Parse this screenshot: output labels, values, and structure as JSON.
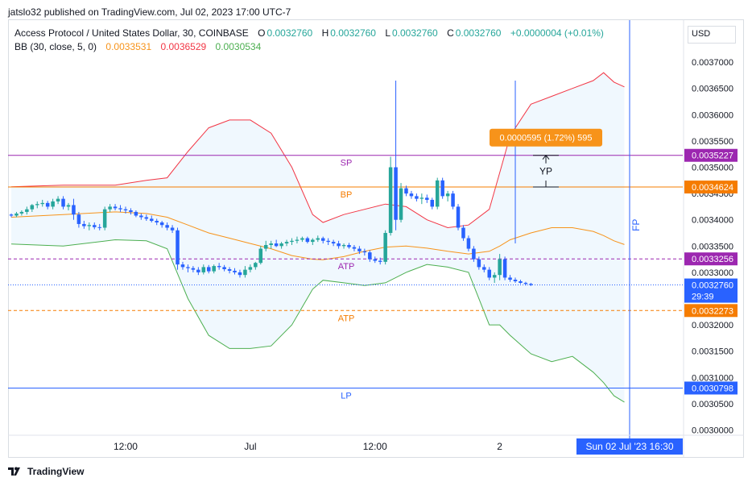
{
  "header": {
    "publisher_note": "jatslo32 published on TradingView.com, Jul 02, 2023 17:00 UTC-7"
  },
  "legend": {
    "symbol": "Access Protocol / United States Dollar, 30, COINBASE",
    "o_label": "O",
    "o_value": "0.0032760",
    "h_label": "H",
    "h_value": "0.0032760",
    "l_label": "L",
    "l_value": "0.0032760",
    "c_label": "C",
    "c_value": "0.0032760",
    "change": "+0.0000004 (+0.01%)",
    "bb_label": "BB (30, close, 5, 0)",
    "bb_basis": "0.0033531",
    "bb_upper": "0.0036529",
    "bb_lower": "0.0030534"
  },
  "currency": "USD",
  "footer": {
    "brand": "TradingView"
  },
  "colors": {
    "up": "#26a69a",
    "down": "#2962ff",
    "upper": "#f23645",
    "basis": "#f7931a",
    "lower": "#4caf50",
    "fill": "#e3f2fd",
    "sp": "#9c27b0",
    "bp": "#f57c00",
    "lp": "#2962ff",
    "atp_top": "#9c27b0",
    "atp_bottom": "#f57c00",
    "last": "#2962ff",
    "fp": "#2962ff"
  },
  "chart_data": {
    "type": "candlestick",
    "ylim": [
      0.00299,
      0.00378
    ],
    "y_ticks": [
      "0.0030000",
      "0.0030500",
      "0.0031000",
      "0.0031500",
      "0.0032000",
      "0.0032500",
      "0.0033000",
      "0.0033500",
      "0.0034000",
      "0.0034500",
      "0.0035000",
      "0.0035500",
      "0.0036000",
      "0.0036500",
      "0.0037000"
    ],
    "x_ticks": [
      {
        "index": 22,
        "label": "12:00"
      },
      {
        "index": 46,
        "label": "Jul"
      },
      {
        "index": 70,
        "label": "12:00"
      },
      {
        "index": 94,
        "label": "2"
      }
    ],
    "candles": [
      [
        0.00341,
        0.003412,
        0.003405,
        0.003408
      ],
      [
        0.003408,
        0.003415,
        0.003405,
        0.003412
      ],
      [
        0.003412,
        0.003418,
        0.003408,
        0.003415
      ],
      [
        0.003415,
        0.003425,
        0.00341,
        0.00342
      ],
      [
        0.00342,
        0.00343,
        0.003415,
        0.003428
      ],
      [
        0.003428,
        0.003435,
        0.003422,
        0.00343
      ],
      [
        0.00343,
        0.003438,
        0.003425,
        0.003432
      ],
      [
        0.003432,
        0.003436,
        0.00342,
        0.003425
      ],
      [
        0.003425,
        0.00344,
        0.00342,
        0.003435
      ],
      [
        0.003435,
        0.003445,
        0.00343,
        0.00344
      ],
      [
        0.00344,
        0.003445,
        0.00342,
        0.003425
      ],
      [
        0.003425,
        0.003432,
        0.003418,
        0.003428
      ],
      [
        0.003428,
        0.00344,
        0.0034,
        0.00341
      ],
      [
        0.00341,
        0.003415,
        0.003385,
        0.003392
      ],
      [
        0.003392,
        0.003398,
        0.003383,
        0.003388
      ],
      [
        0.003388,
        0.003395,
        0.00338,
        0.00339
      ],
      [
        0.00339,
        0.003395,
        0.003382,
        0.003386
      ],
      [
        0.003386,
        0.003392,
        0.00338,
        0.003385
      ],
      [
        0.003385,
        0.003425,
        0.00338,
        0.00342
      ],
      [
        0.00342,
        0.00343,
        0.003415,
        0.003425
      ],
      [
        0.003425,
        0.00343,
        0.003418,
        0.003422
      ],
      [
        0.003422,
        0.003428,
        0.003415,
        0.00342
      ],
      [
        0.00342,
        0.003425,
        0.003412,
        0.003418
      ],
      [
        0.003418,
        0.003422,
        0.00341,
        0.003415
      ],
      [
        0.003415,
        0.003418,
        0.003405,
        0.003408
      ],
      [
        0.003408,
        0.003412,
        0.0034,
        0.003405
      ],
      [
        0.003405,
        0.00341,
        0.003398,
        0.003402
      ],
      [
        0.003402,
        0.003408,
        0.003395,
        0.003398
      ],
      [
        0.003398,
        0.003402,
        0.00339,
        0.003395
      ],
      [
        0.003395,
        0.003398,
        0.003385,
        0.00339
      ],
      [
        0.00339,
        0.003395,
        0.00338,
        0.003385
      ],
      [
        0.003385,
        0.00339,
        0.003375,
        0.00338
      ],
      [
        0.00338,
        0.003385,
        0.003305,
        0.003315
      ],
      [
        0.003315,
        0.00332,
        0.003305,
        0.00331
      ],
      [
        0.00331,
        0.003315,
        0.0033,
        0.003308
      ],
      [
        0.003308,
        0.003312,
        0.0033,
        0.003305
      ],
      [
        0.003305,
        0.00331,
        0.003295,
        0.0033
      ],
      [
        0.0033,
        0.003315,
        0.003296,
        0.00331
      ],
      [
        0.00331,
        0.003314,
        0.003298,
        0.003302
      ],
      [
        0.003302,
        0.003315,
        0.003298,
        0.003312
      ],
      [
        0.003312,
        0.003318,
        0.003305,
        0.00331
      ],
      [
        0.00331,
        0.003314,
        0.003302,
        0.003306
      ],
      [
        0.003306,
        0.00331,
        0.003298,
        0.003303
      ],
      [
        0.003303,
        0.003308,
        0.003296,
        0.0033
      ],
      [
        0.0033,
        0.003305,
        0.00329,
        0.003295
      ],
      [
        0.003295,
        0.003312,
        0.00329,
        0.003305
      ],
      [
        0.003305,
        0.003315,
        0.0033,
        0.00331
      ],
      [
        0.00331,
        0.00332,
        0.003305,
        0.003318
      ],
      [
        0.003318,
        0.00335,
        0.003315,
        0.003345
      ],
      [
        0.003345,
        0.00336,
        0.00334,
        0.003352
      ],
      [
        0.003352,
        0.00336,
        0.003345,
        0.003355
      ],
      [
        0.003355,
        0.003362,
        0.003348,
        0.00335
      ],
      [
        0.00335,
        0.003358,
        0.003345,
        0.003355
      ],
      [
        0.003355,
        0.003362,
        0.00335,
        0.003358
      ],
      [
        0.003358,
        0.003365,
        0.003352,
        0.00336
      ],
      [
        0.00336,
        0.003368,
        0.003355,
        0.003362
      ],
      [
        0.003362,
        0.003368,
        0.003358,
        0.003365
      ],
      [
        0.003365,
        0.003368,
        0.003355,
        0.003358
      ],
      [
        0.003358,
        0.003365,
        0.003352,
        0.003362
      ],
      [
        0.003362,
        0.00337,
        0.003358,
        0.003365
      ],
      [
        0.003365,
        0.003368,
        0.003355,
        0.00336
      ],
      [
        0.00336,
        0.003365,
        0.003352,
        0.003358
      ],
      [
        0.003358,
        0.003362,
        0.00335,
        0.003355
      ],
      [
        0.003355,
        0.00336,
        0.003345,
        0.00335
      ],
      [
        0.00335,
        0.003355,
        0.003345,
        0.003352
      ],
      [
        0.003352,
        0.003356,
        0.003345,
        0.003348
      ],
      [
        0.003348,
        0.003352,
        0.00334,
        0.003345
      ],
      [
        0.003345,
        0.00335,
        0.003335,
        0.00334
      ],
      [
        0.00334,
        0.003345,
        0.003332,
        0.003338
      ],
      [
        0.003338,
        0.003342,
        0.00332,
        0.003325
      ],
      [
        0.003325,
        0.00333,
        0.003318,
        0.003322
      ],
      [
        0.003322,
        0.003328,
        0.003315,
        0.00332
      ],
      [
        0.00332,
        0.00338,
        0.003315,
        0.003375
      ],
      [
        0.003375,
        0.00352,
        0.00337,
        0.0035
      ],
      [
        0.0035,
        0.003665,
        0.00338,
        0.0034
      ],
      [
        0.0034,
        0.00347,
        0.003395,
        0.00346
      ],
      [
        0.00346,
        0.003465,
        0.003445,
        0.00345
      ],
      [
        0.00345,
        0.003455,
        0.00344,
        0.003445
      ],
      [
        0.003445,
        0.00345,
        0.003435,
        0.00344
      ],
      [
        0.00344,
        0.00345,
        0.00343,
        0.003442
      ],
      [
        0.003442,
        0.003448,
        0.003432,
        0.003438
      ],
      [
        0.003438,
        0.003442,
        0.00342,
        0.003425
      ],
      [
        0.003425,
        0.00348,
        0.00342,
        0.003475
      ],
      [
        0.003475,
        0.00348,
        0.00344,
        0.003445
      ],
      [
        0.003445,
        0.003455,
        0.003435,
        0.00345
      ],
      [
        0.00345,
        0.003455,
        0.00342,
        0.003425
      ],
      [
        0.003425,
        0.00343,
        0.00338,
        0.003385
      ],
      [
        0.003385,
        0.00339,
        0.00336,
        0.003365
      ],
      [
        0.003365,
        0.00337,
        0.00334,
        0.003345
      ],
      [
        0.003345,
        0.00335,
        0.00332,
        0.003325
      ],
      [
        0.003325,
        0.00333,
        0.003305,
        0.00331
      ],
      [
        0.00331,
        0.003315,
        0.0033,
        0.003305
      ],
      [
        0.003305,
        0.00331,
        0.003285,
        0.00329
      ],
      [
        0.00329,
        0.0033,
        0.00328,
        0.003295
      ],
      [
        0.003295,
        0.003335,
        0.003285,
        0.003325
      ],
      [
        0.003325,
        0.00333,
        0.003285,
        0.00329
      ],
      [
        0.00329,
        0.003295,
        0.003282,
        0.003286
      ],
      [
        0.003286,
        0.00329,
        0.00328,
        0.003283
      ],
      [
        0.003283,
        0.003286,
        0.003278,
        0.00328
      ],
      [
        0.00328,
        0.003282,
        0.003275,
        0.003278
      ],
      [
        0.003278,
        0.00328,
        0.003274,
        0.003276
      ]
    ],
    "candle_index_offset": 0,
    "bb_upper": [
      [
        0,
        0.003463
      ],
      [
        10,
        0.003466
      ],
      [
        20,
        0.003466
      ],
      [
        26,
        0.003475
      ],
      [
        30,
        0.00348
      ],
      [
        34,
        0.00353
      ],
      [
        38,
        0.003575
      ],
      [
        42,
        0.00359
      ],
      [
        46,
        0.00359
      ],
      [
        50,
        0.003565
      ],
      [
        54,
        0.0035
      ],
      [
        58,
        0.00341
      ],
      [
        60,
        0.003395
      ],
      [
        64,
        0.00341
      ],
      [
        68,
        0.00342
      ],
      [
        72,
        0.00343
      ],
      [
        76,
        0.003425
      ],
      [
        80,
        0.0034
      ],
      [
        84,
        0.003385
      ],
      [
        88,
        0.00339
      ],
      [
        92,
        0.00342
      ],
      [
        94,
        0.00349
      ],
      [
        96,
        0.00356
      ],
      [
        100,
        0.00362
      ],
      [
        104,
        0.003635
      ],
      [
        108,
        0.00365
      ],
      [
        112,
        0.003665
      ],
      [
        114,
        0.00368
      ],
      [
        116,
        0.003662
      ],
      [
        118,
        0.003653
      ]
    ],
    "bb_basis": [
      [
        0,
        0.003405
      ],
      [
        10,
        0.00341
      ],
      [
        20,
        0.003415
      ],
      [
        26,
        0.003412
      ],
      [
        30,
        0.003405
      ],
      [
        34,
        0.00339
      ],
      [
        38,
        0.003375
      ],
      [
        42,
        0.003365
      ],
      [
        46,
        0.003355
      ],
      [
        50,
        0.003345
      ],
      [
        54,
        0.003332
      ],
      [
        58,
        0.003325
      ],
      [
        60,
        0.003324
      ],
      [
        64,
        0.00333
      ],
      [
        68,
        0.00334
      ],
      [
        72,
        0.003348
      ],
      [
        76,
        0.00335
      ],
      [
        80,
        0.003346
      ],
      [
        84,
        0.00334
      ],
      [
        88,
        0.003335
      ],
      [
        92,
        0.00334
      ],
      [
        94,
        0.00335
      ],
      [
        96,
        0.003362
      ],
      [
        100,
        0.003375
      ],
      [
        104,
        0.003385
      ],
      [
        108,
        0.003385
      ],
      [
        112,
        0.003378
      ],
      [
        114,
        0.00337
      ],
      [
        116,
        0.00336
      ],
      [
        118,
        0.003353
      ]
    ],
    "bb_lower": [
      [
        0,
        0.003354
      ],
      [
        10,
        0.00335
      ],
      [
        20,
        0.003362
      ],
      [
        26,
        0.00336
      ],
      [
        30,
        0.003345
      ],
      [
        34,
        0.00325
      ],
      [
        38,
        0.00318
      ],
      [
        42,
        0.003155
      ],
      [
        46,
        0.003155
      ],
      [
        50,
        0.00316
      ],
      [
        54,
        0.0032
      ],
      [
        58,
        0.003268
      ],
      [
        60,
        0.003285
      ],
      [
        64,
        0.00328
      ],
      [
        68,
        0.003275
      ],
      [
        72,
        0.00328
      ],
      [
        76,
        0.0033
      ],
      [
        80,
        0.003315
      ],
      [
        84,
        0.00331
      ],
      [
        88,
        0.0033
      ],
      [
        92,
        0.0032
      ],
      [
        94,
        0.0032
      ],
      [
        96,
        0.00318
      ],
      [
        100,
        0.003145
      ],
      [
        104,
        0.00313
      ],
      [
        108,
        0.00314
      ],
      [
        112,
        0.00311
      ],
      [
        114,
        0.00309
      ],
      [
        116,
        0.003065
      ],
      [
        118,
        0.003053
      ]
    ],
    "levels": [
      {
        "name": "SP",
        "value": 0.0035227,
        "label": "0.0035227",
        "style": "solid",
        "color": "#9c27b0"
      },
      {
        "name": "BP",
        "value": 0.0034624,
        "label": "0.0034624",
        "style": "solid",
        "color": "#f57c00"
      },
      {
        "name": "ATP",
        "value": 0.0033256,
        "label": "0.0033256",
        "style": "dashed",
        "color": "#9c27b0"
      },
      {
        "name": "ATP",
        "value": 0.0032273,
        "label": "0.0032273",
        "style": "dashed",
        "color": "#f57c00"
      },
      {
        "name": "LP",
        "value": 0.0030798,
        "label": "0.0030798",
        "style": "solid",
        "color": "#2962ff"
      }
    ],
    "last_price": {
      "value": 0.003276,
      "label": "0.0032760",
      "countdown": "29:39"
    },
    "measure": {
      "text": "0.0000595 (1.72%) 595",
      "from": 0.0034624,
      "to": 0.0035227,
      "index": 97
    },
    "yp_label": "YP",
    "fp_label": "FP",
    "fp_index": 119,
    "crosshair_index": 97,
    "time_label": "Sun 02 Jul '23   16:30",
    "bar_count": 120
  }
}
